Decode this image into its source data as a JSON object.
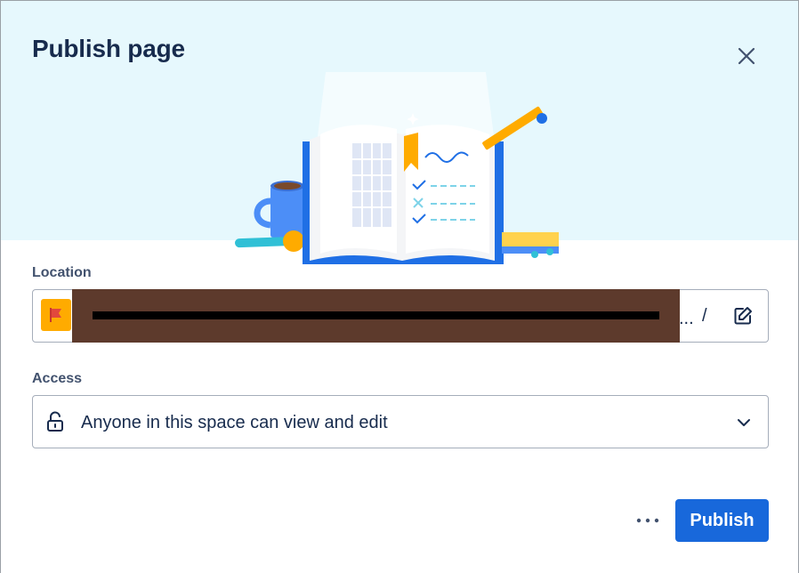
{
  "dialog": {
    "title": "Publish page",
    "close_icon": "close-icon"
  },
  "location": {
    "label": "Location",
    "space_icon": "flag-icon",
    "path_ellipsis": "...",
    "path_separator": "/",
    "edit_icon": "edit-icon"
  },
  "access": {
    "label": "Access",
    "value": "Anyone in this space can view and edit",
    "icon": "unlock-icon",
    "dropdown_icon": "chevron-down-icon"
  },
  "footer": {
    "more_icon": "more-icon",
    "publish_label": "Publish"
  },
  "colors": {
    "hero_background": "#e6f8fd",
    "primary": "#1868db",
    "title_text": "#172b4d",
    "label_text": "#42526e",
    "border": "#a5adba",
    "space_avatar": "#ffab00"
  }
}
